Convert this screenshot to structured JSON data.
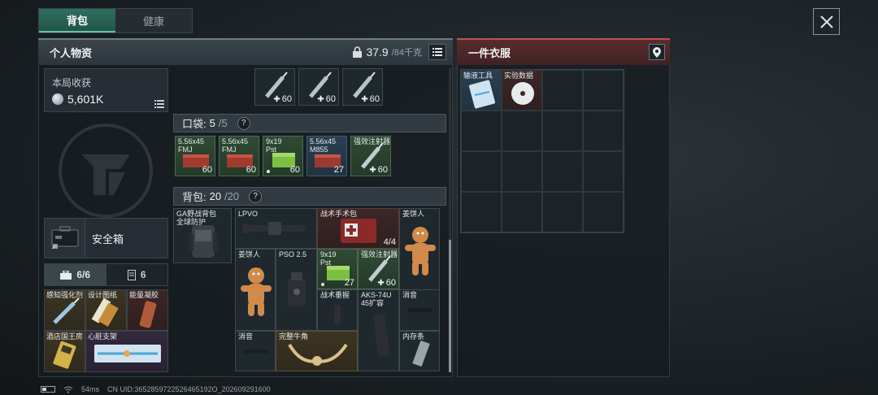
{
  "tabs": [
    {
      "label": "背包",
      "active": true
    },
    {
      "label": "健康",
      "active": false
    }
  ],
  "personal": {
    "title": "个人物资",
    "weight_current": "37.9",
    "weight_max": "/84千克"
  },
  "income": {
    "label": "本局收获",
    "value": "5,601K"
  },
  "safe_box": {
    "label": "安全箱"
  },
  "mini_tabs": [
    {
      "label": "6/6",
      "icon": "briefcase-icon"
    },
    {
      "label": "6",
      "icon": "locker-icon"
    }
  ],
  "safe_items": [
    {
      "label": "感知强化剂",
      "color": "gold"
    },
    {
      "label": "设计图纸",
      "color": "gold"
    },
    {
      "label": "能量凝胶",
      "color": "red"
    },
    {
      "label": "酒店国王房",
      "color": "gold"
    },
    {
      "label": "心脏支架",
      "color": "purple"
    }
  ],
  "top_items": [
    {
      "name": "强效注射器",
      "qty": "60"
    },
    {
      "name": "强效注射器",
      "qty": "60"
    },
    {
      "name": "强效注射器",
      "qty": "60"
    }
  ],
  "pocket": {
    "label": "口袋:",
    "count": "5",
    "max": "/5",
    "items": [
      {
        "name": "5.56x45\nFMJ",
        "qty": "60",
        "color": "green",
        "icon": "ammo-box-icon"
      },
      {
        "name": "5.56x45\nFMJ",
        "qty": "60",
        "color": "green",
        "icon": "ammo-box-icon"
      },
      {
        "name": "9x19\nPst",
        "qty": "60",
        "color": "green",
        "icon": "ammo-box-icon"
      },
      {
        "name": "5.56x45\nM855",
        "qty": "27",
        "color": "blue",
        "icon": "ammo-box-icon"
      },
      {
        "name": "强效注射器",
        "qty": "60",
        "color": "green",
        "icon": "syringe-icon"
      }
    ]
  },
  "backpack": {
    "label": "背包:",
    "count": "20",
    "max": "/20",
    "bag_name": "GA野战背包\n全球防护",
    "items": [
      {
        "name": "LPVO",
        "qty": ""
      },
      {
        "name": "战术手术包",
        "qty": "4/4"
      },
      {
        "name": "姜饼人",
        "qty": ""
      },
      {
        "name": "姜饼人",
        "qty": ""
      },
      {
        "name": "PSO 2.5",
        "qty": ""
      },
      {
        "name": "9x19\nPst",
        "qty": "27"
      },
      {
        "name": "强效注射器",
        "qty": "60"
      },
      {
        "name": "战术垂握",
        "qty": ""
      },
      {
        "name": "AKS-74U\n45扩容",
        "qty": ""
      },
      {
        "name": "消音",
        "qty": ""
      },
      {
        "name": "消音",
        "qty": ""
      },
      {
        "name": "完整牛角",
        "qty": ""
      },
      {
        "name": "内存条",
        "qty": ""
      }
    ]
  },
  "clothes": {
    "title": "一件衣服",
    "items": [
      {
        "name": "输液工具"
      },
      {
        "name": "实验数据"
      }
    ]
  },
  "status": {
    "ping": "54ms",
    "uid": "CN UID:3652859722526465192O_202609291600"
  }
}
